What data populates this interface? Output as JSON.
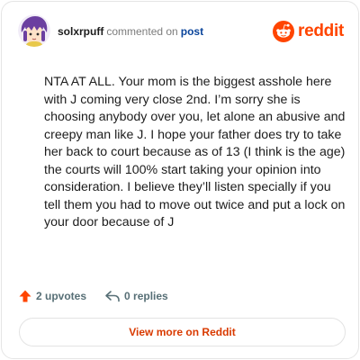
{
  "header": {
    "username": "solxrpuff",
    "action": "commented on",
    "post_link": "post",
    "brand": "reddit"
  },
  "comment": {
    "text": "NTA AT ALL. Your mom is the biggest asshole here with J coming very close 2nd. I’m sorry she is choosing anybody over you, let alone an abusive and creepy man like J. I hope your father does try to take her back to court because as of 13 (I think is the age) the courts will 100% start taking your opinion into consideration. I believe they’ll listen specially if you tell them you had to move out twice and put a lock on your door because of J"
  },
  "footer": {
    "upvotes": "2 upvotes",
    "replies": "0 replies"
  },
  "cta": {
    "label": "View more on Reddit"
  },
  "colors": {
    "brand": "#ff4500",
    "link": "#0a449b",
    "cta_text": "#d93a00",
    "avatar_purple": "#6b3fa0"
  },
  "icons": [
    "avatar",
    "reddit-logo-icon",
    "upvote-arrow-icon",
    "reply-icon"
  ]
}
